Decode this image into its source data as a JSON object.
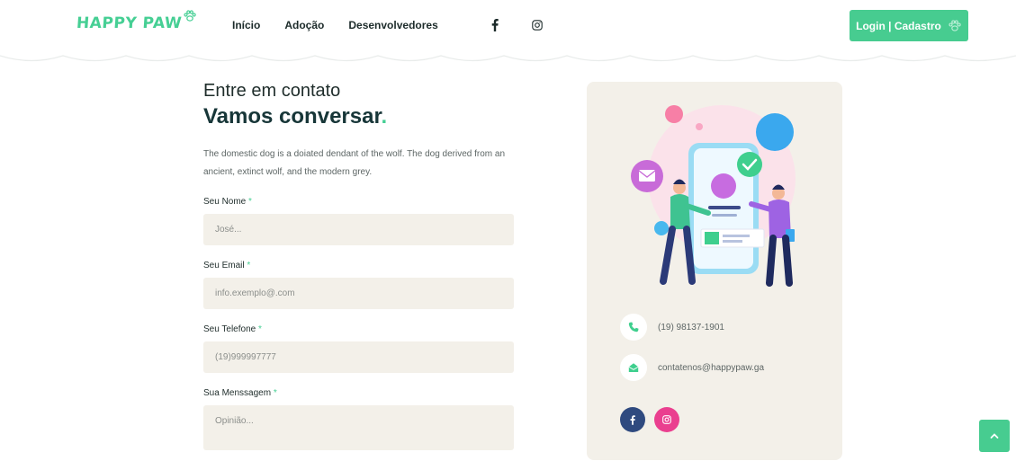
{
  "header": {
    "logo_text": "HAPPY PAW",
    "nav": [
      {
        "label": "Início"
      },
      {
        "label": "Adoção"
      },
      {
        "label": "Desenvolvedores"
      }
    ],
    "social_icons": [
      "facebook-icon",
      "instagram-icon"
    ],
    "login_label": "Login | Cadastro"
  },
  "contact": {
    "eyebrow": "Entre em contato",
    "headline": "Vamos conversar",
    "headline_dot": ".",
    "description": "The domestic dog is a doiated dendant of the wolf. The dog derived from an ancient, extinct wolf, and the modern grey.",
    "fields": [
      {
        "label": "Seu Nome",
        "placeholder": "José..."
      },
      {
        "label": "Seu Email",
        "placeholder": "info.exemplo@.com"
      },
      {
        "label": "Seu Telefone",
        "placeholder": "(19)999997777"
      },
      {
        "label": "Sua Menssagem",
        "placeholder": "Opinião..."
      }
    ],
    "required_mark": "*"
  },
  "card": {
    "phone": "(19) 98137-1901",
    "email": "contatenos@happypaw.ga",
    "social_icons": [
      "facebook-icon",
      "instagram-icon"
    ]
  },
  "colors": {
    "accent": "#46cf94",
    "dark": "#173638",
    "card_bg": "#f3f0e9",
    "facebook": "#2f4a7f",
    "instagram": "#ea3f8f"
  }
}
